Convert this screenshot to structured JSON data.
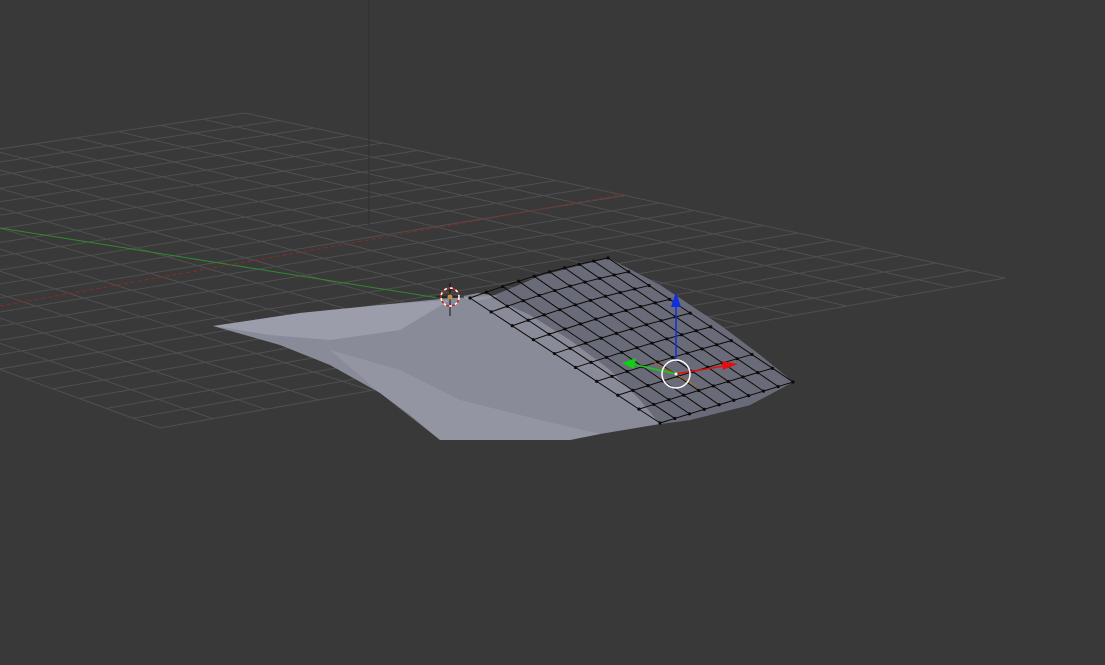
{
  "colors": {
    "background": "#393939",
    "grid": "#4f4f4f",
    "x_axis": "#8a2a2a",
    "y_axis": "#2f8a2f",
    "z_axis": "#333333",
    "mesh_fill": "#8a8b98",
    "mesh_fill_light": "#a9aab6",
    "mesh_edit_face": "#6a6b78",
    "wire": "#0a0a0a",
    "gizmo_x": "#e01010",
    "gizmo_y": "#10d010",
    "gizmo_z": "#1030e0",
    "gizmo_ring": "#ffffff",
    "cursor_ring": "#d02020",
    "cursor_center": "#c88a40"
  },
  "grid": {
    "divisions_u": 22,
    "divisions_v": 16
  },
  "mesh": {
    "rows": 5,
    "cols": 9
  }
}
